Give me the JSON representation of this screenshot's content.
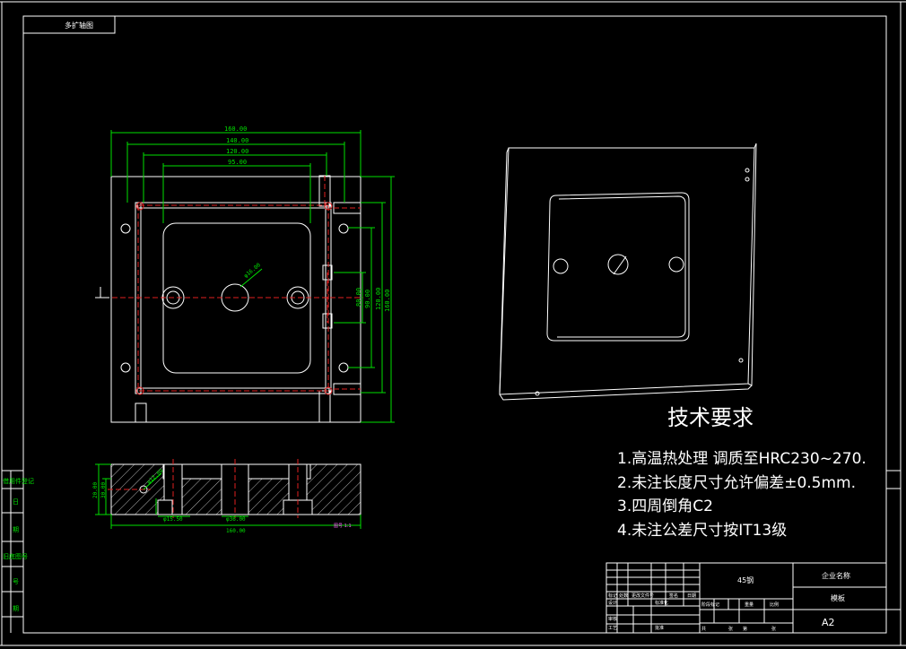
{
  "drawing": {
    "top_left_label": "多扩轴图",
    "tech_requirements": {
      "title": "技术要求",
      "items": [
        "1.高温热处理  调质至HRC230~270.",
        "2.未注长度尺寸允许偏差±0.5mm.",
        "3.四周倒角C2",
        "4.未注公差尺寸按IT13级"
      ]
    },
    "front_view_dims": {
      "width_160": "160.00",
      "width_140": "140.00",
      "width_120": "120.00",
      "width_95": "95.00",
      "center_dia": "φ16.00",
      "height_vals": [
        "80.00",
        "90.00",
        "120.00",
        "160.00"
      ]
    },
    "section_view_dims": {
      "left_h1": "20.00",
      "left_h2": "30.00",
      "hole_dia": "φ12.00",
      "bottom_a": "φ15.50",
      "bottom_b": "φ36.00",
      "total": "160.00",
      "small_label": "图号 1:1"
    },
    "left_margin_labels": [
      "借用件登记",
      "日",
      "期",
      "旧底图号",
      "号",
      "期"
    ],
    "title_block": {
      "material": "45钢",
      "company": "企业名称",
      "part": "模板",
      "sheet": "A2",
      "row_labels": [
        "标记",
        "处数",
        "更改文件号",
        "签名",
        "日期"
      ],
      "role_labels": [
        "设计",
        "标准化",
        "审核",
        "工艺",
        "批准"
      ],
      "stage_labels": [
        "阶段标记",
        "重量",
        "比例"
      ],
      "sheet_labels": [
        "共",
        "张",
        "第",
        "张"
      ]
    }
  }
}
